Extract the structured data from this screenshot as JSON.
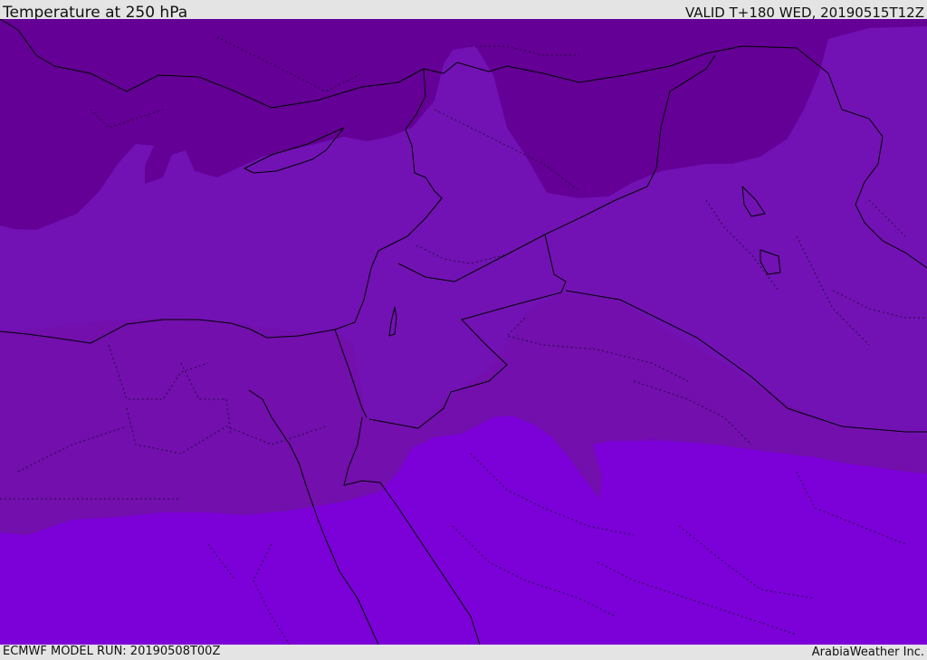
{
  "header": {
    "title": "Temperature at 250 hPa",
    "valid": "VALID T+180 WED, 20190515T12Z"
  },
  "footer": {
    "model_run": "ECMWF MODEL RUN: 20190508T00Z",
    "credit": "ArabiaWeather Inc."
  },
  "map": {
    "colors": {
      "coldest_band": "#640096",
      "cold_band": "#7212b4",
      "mid_band": "#730ca8",
      "warm_band": "#7c00d8",
      "lines": "#000000"
    }
  }
}
